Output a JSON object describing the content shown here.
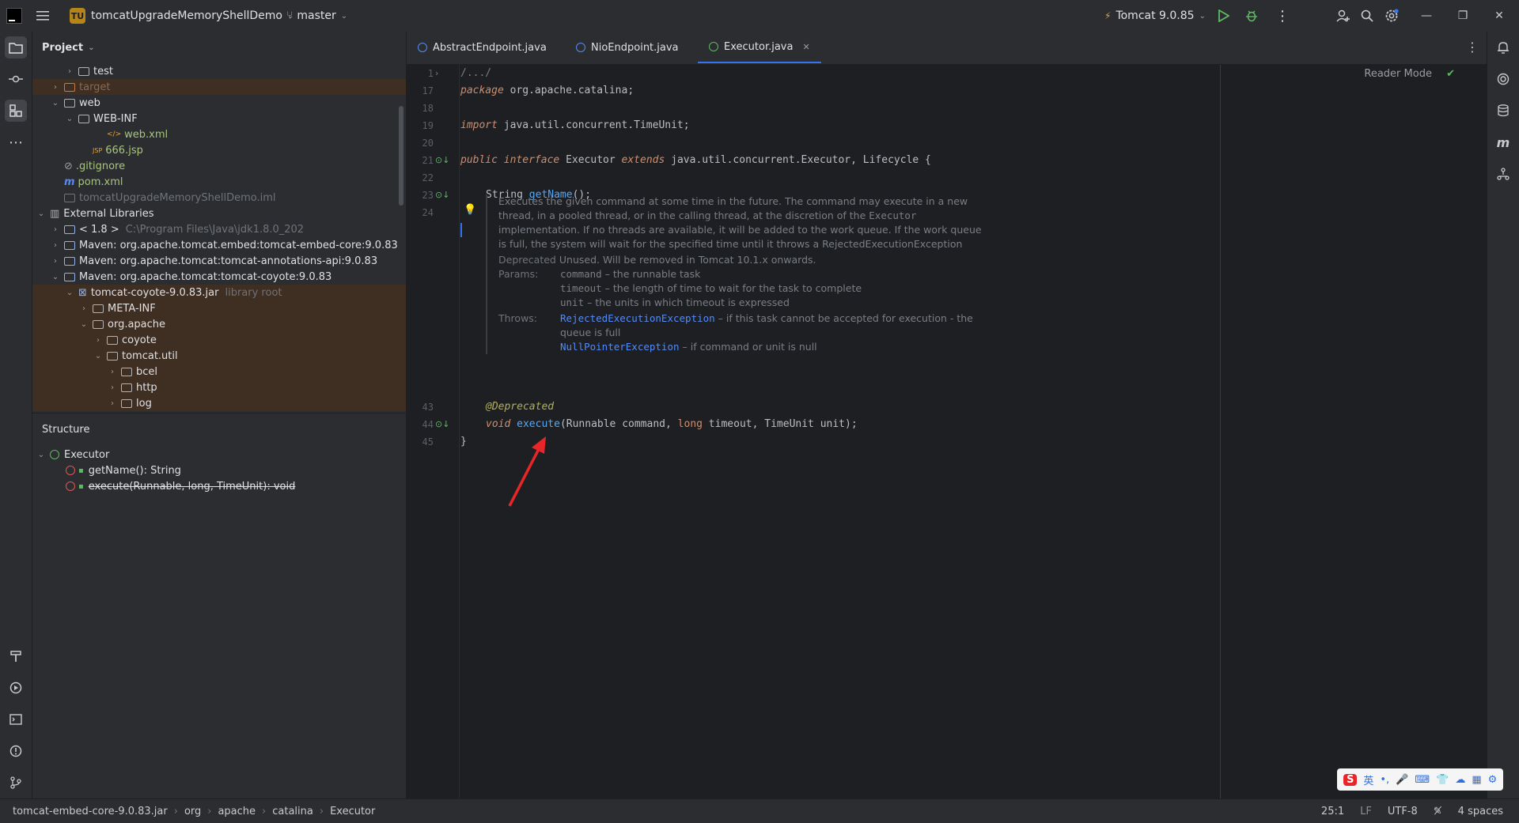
{
  "titlebar": {
    "project_badge": "TU",
    "project_name": "tomcatUpgradeMemoryShellDemo",
    "branch": "master",
    "run_config": "Tomcat 9.0.85"
  },
  "project_panel": {
    "title": "Project",
    "rows": [
      {
        "label": "test",
        "dim": ""
      },
      {
        "label": "target",
        "dim": ""
      },
      {
        "label": "web",
        "dim": ""
      },
      {
        "label": "WEB-INF",
        "dim": ""
      },
      {
        "label": "web.xml",
        "dim": ""
      },
      {
        "label": "666.jsp",
        "dim": ""
      },
      {
        "label": ".gitignore",
        "dim": ""
      },
      {
        "label": "pom.xml",
        "dim": ""
      },
      {
        "label": "tomcatUpgradeMemoryShellDemo.iml",
        "dim": ""
      },
      {
        "label": "External Libraries",
        "dim": ""
      },
      {
        "label": "< 1.8 >",
        "dim": "C:\\Program Files\\Java\\jdk1.8.0_202"
      },
      {
        "label": "Maven: org.apache.tomcat.embed:tomcat-embed-core:9.0.83",
        "dim": ""
      },
      {
        "label": "Maven: org.apache.tomcat:tomcat-annotations-api:9.0.83",
        "dim": ""
      },
      {
        "label": "Maven: org.apache.tomcat:tomcat-coyote:9.0.83",
        "dim": ""
      },
      {
        "label": "tomcat-coyote-9.0.83.jar",
        "dim": "library root"
      },
      {
        "label": "META-INF",
        "dim": ""
      },
      {
        "label": "org.apache",
        "dim": ""
      },
      {
        "label": "coyote",
        "dim": ""
      },
      {
        "label": "tomcat.util",
        "dim": ""
      },
      {
        "label": "bcel",
        "dim": ""
      },
      {
        "label": "http",
        "dim": ""
      },
      {
        "label": "log",
        "dim": ""
      }
    ]
  },
  "structure_panel": {
    "title": "Structure",
    "root": "Executor",
    "members": [
      "getName(): String",
      "execute(Runnable, long, TimeUnit): void"
    ]
  },
  "tabs": [
    {
      "label": "AbstractEndpoint.java"
    },
    {
      "label": "NioEndpoint.java"
    },
    {
      "label": "Executor.java"
    }
  ],
  "editor": {
    "reader_mode": "Reader Mode",
    "line_numbers": [
      "1",
      "17",
      "18",
      "19",
      "20",
      "21",
      "22",
      "23",
      "24",
      "43",
      "44",
      "45"
    ],
    "fold_line": "/.../",
    "package_kw": "package",
    "package_name": "org.apache.catalina;",
    "import_kw": "import",
    "import_name": "java.util.concurrent.TimeUnit;",
    "line21": {
      "k1": "public",
      "k2": "interface",
      "name": "Executor",
      "k3": "extends",
      "rest": "java.util.concurrent.Executor, Lifecycle {"
    },
    "line23": {
      "type": "String",
      "fn": "getName",
      "rest": "();"
    },
    "annotation": "@Deprecated",
    "line44": {
      "k1": "void",
      "fn": "execute",
      "p1": "(Runnable ",
      "a1": "command",
      "p2": ", ",
      "k2": "long",
      "a2": " timeout",
      "p3": ", TimeUnit ",
      "a3": "unit",
      "p4": ");"
    },
    "close_brace": "}",
    "doc": {
      "desc1": "Executes the given command at some time in the future. The command may execute in a new",
      "desc2a": "thread, in a pooled thread, or in the calling thread, at the discretion of the",
      "desc2b": "Executor",
      "desc3": "implementation. If no threads are available, it will be added to the work queue. If the work queue",
      "desc4": "is full, the system will wait for the specified time until it throws a RejectedExecutionException",
      "deprecated_label": "Deprecated",
      "deprecated_text": "Unused. Will be removed in Tomcat 10.1.x onwards.",
      "params_label": "Params:",
      "params": [
        {
          "name": "command",
          "text": "– the runnable task"
        },
        {
          "name": "timeout",
          "text": "– the length of time to wait for the task to complete"
        },
        {
          "name": "unit",
          "text": "– the units in which timeout is expressed"
        }
      ],
      "throws_label": "Throws:",
      "throws": [
        {
          "name": "RejectedExecutionException",
          "text": "– if this task cannot be accepted for execution - the"
        },
        {
          "name": "",
          "text": "queue is full"
        },
        {
          "name": "NullPointerException",
          "text": "– if command or unit is null"
        }
      ]
    }
  },
  "statusbar": {
    "crumbs": [
      "tomcat-embed-core-9.0.83.jar",
      "org",
      "apache",
      "catalina",
      "Executor"
    ],
    "position": "25:1",
    "line_sep": "LF",
    "encoding": "UTF-8",
    "indent": "4 spaces"
  },
  "ime": {
    "lang": "英"
  },
  "colors": {
    "accent": "#3574f0",
    "run_green": "#5fb865",
    "arrow": "#e8262a"
  }
}
